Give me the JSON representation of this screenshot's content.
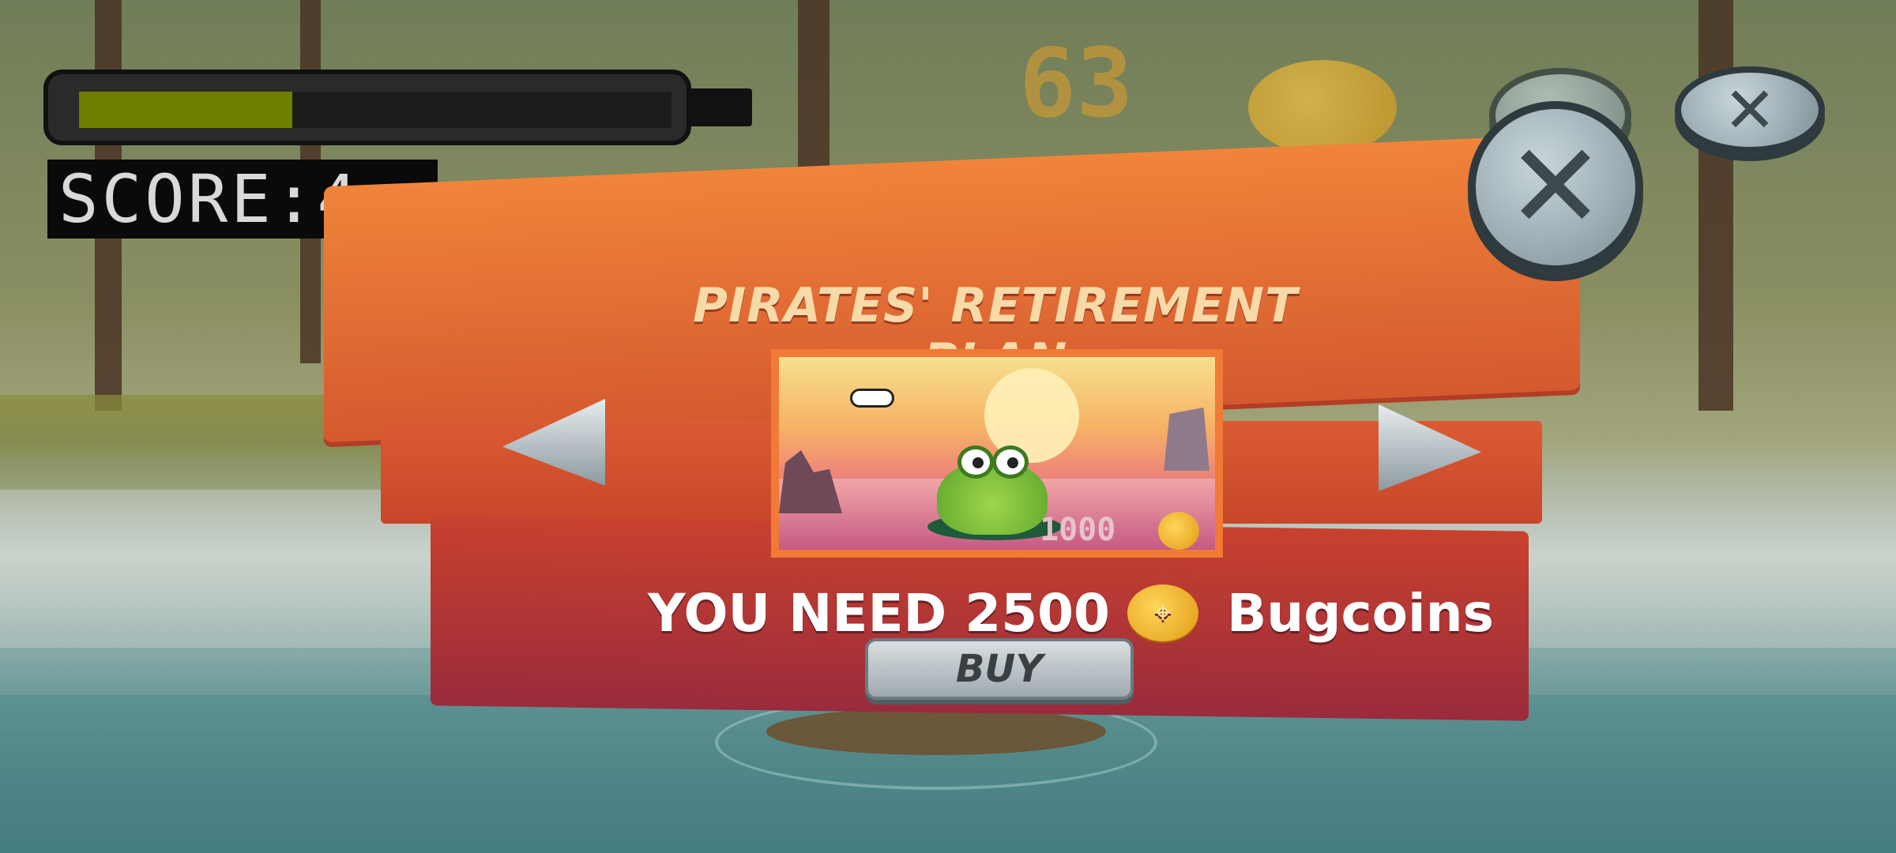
{
  "hud": {
    "energy_fraction": 0.36,
    "score_label": "SCORE:4"
  },
  "top": {
    "coin_count": "63",
    "close_icon": "close-icon",
    "settings_icon": "round-button-icon"
  },
  "modal": {
    "title": "PIRATES' RETIREMENT PLAN",
    "preview": {
      "price": "1000",
      "coin_icon": "bugcoin-icon"
    },
    "need_prefix": "YOU NEED 2500",
    "need_suffix": "Bugcoins",
    "buy_label": "BUY",
    "prev_icon": "arrow-left-icon",
    "next_icon": "arrow-right-icon",
    "close_icon": "close-icon"
  },
  "colors": {
    "accent_orange": "#f07a36",
    "board_red": "#c8412e",
    "energy_green": "#6f7d00",
    "coin_gold": "#f2b02a"
  }
}
